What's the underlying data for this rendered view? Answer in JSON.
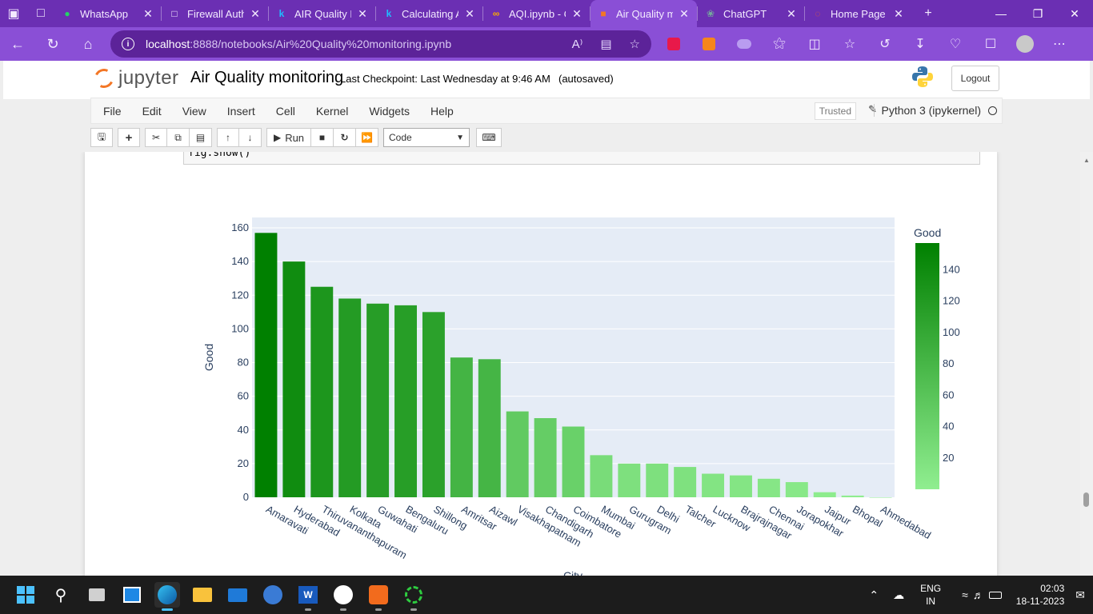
{
  "browser": {
    "tabs": [
      {
        "label": "",
        "icon": "workspaces-icon",
        "color": "#f3eaff"
      },
      {
        "label": "WhatsApp",
        "icon": "whatsapp-icon",
        "color": "#25d366"
      },
      {
        "label": "Firewall Auth",
        "icon": "page-icon",
        "color": "#f3eaff"
      },
      {
        "label": "AIR Quality D",
        "icon": "kaggle-icon",
        "color": "#20beff"
      },
      {
        "label": "Calculating A",
        "icon": "kaggle-icon",
        "color": "#20beff"
      },
      {
        "label": "AQI.ipynb - C",
        "icon": "colab-icon",
        "color": "#f9ab00"
      },
      {
        "label": "Air Quality m",
        "icon": "jupyter-tab-icon",
        "color": "#f37726"
      },
      {
        "label": "ChatGPT",
        "icon": "chatgpt-icon",
        "color": "#74aa9c"
      },
      {
        "label": "Home Page",
        "icon": "loading-icon",
        "color": "#e25a3b"
      }
    ],
    "url_host": "localhost",
    "url_path": ":8888/notebooks/Air%20Quality%20monitoring.ipynb"
  },
  "jupyter": {
    "logo_text": "jupyter",
    "notebook_name": "Air Quality monitoring",
    "checkpoint": "Last Checkpoint: Last Wednesday at 9:46 AM",
    "autosave": "(autosaved)",
    "logout": "Logout",
    "menu": [
      "File",
      "Edit",
      "View",
      "Insert",
      "Cell",
      "Kernel",
      "Widgets",
      "Help"
    ],
    "trusted": "Trusted",
    "kernel": "Python 3 (ipykernel)",
    "toolbar": {
      "run": "Run",
      "cell_type": "Code"
    },
    "code_line": "fig.show()"
  },
  "chart_data": {
    "type": "bar",
    "categories": [
      "Amaravati",
      "Hyderabad",
      "Thiruvananthapuram",
      "Kolkata",
      "Guwahati",
      "Bengaluru",
      "Shillong",
      "Amritsar",
      "Aizawl",
      "Visakhapatnam",
      "Chandigarh",
      "Coimbatore",
      "Mumbai",
      "Gurugram",
      "Delhi",
      "Talcher",
      "Lucknow",
      "Brajrajnagar",
      "Chennai",
      "Jorapokhar",
      "Jaipur",
      "Bhopal",
      "Ahmedabad"
    ],
    "values": [
      157,
      140,
      125,
      118,
      115,
      114,
      110,
      83,
      82,
      51,
      47,
      42,
      25,
      20,
      20,
      18,
      14,
      13,
      11,
      9,
      3,
      1,
      0
    ],
    "xlabel": "City",
    "ylabel": "Good",
    "ylim": [
      0,
      160
    ],
    "yticks": [
      0,
      20,
      40,
      60,
      80,
      100,
      120,
      140,
      160
    ],
    "colorbar": {
      "title": "Good",
      "ticks": [
        20,
        40,
        60,
        80,
        100,
        120,
        140
      ],
      "range": [
        0,
        157
      ],
      "color_low": "#90ee90",
      "color_high": "#008000"
    },
    "plot_bg": "#e5ecf6"
  },
  "taskbar": {
    "lang": "ENG",
    "region": "IN",
    "time": "02:03",
    "date": "18-11-2023"
  }
}
